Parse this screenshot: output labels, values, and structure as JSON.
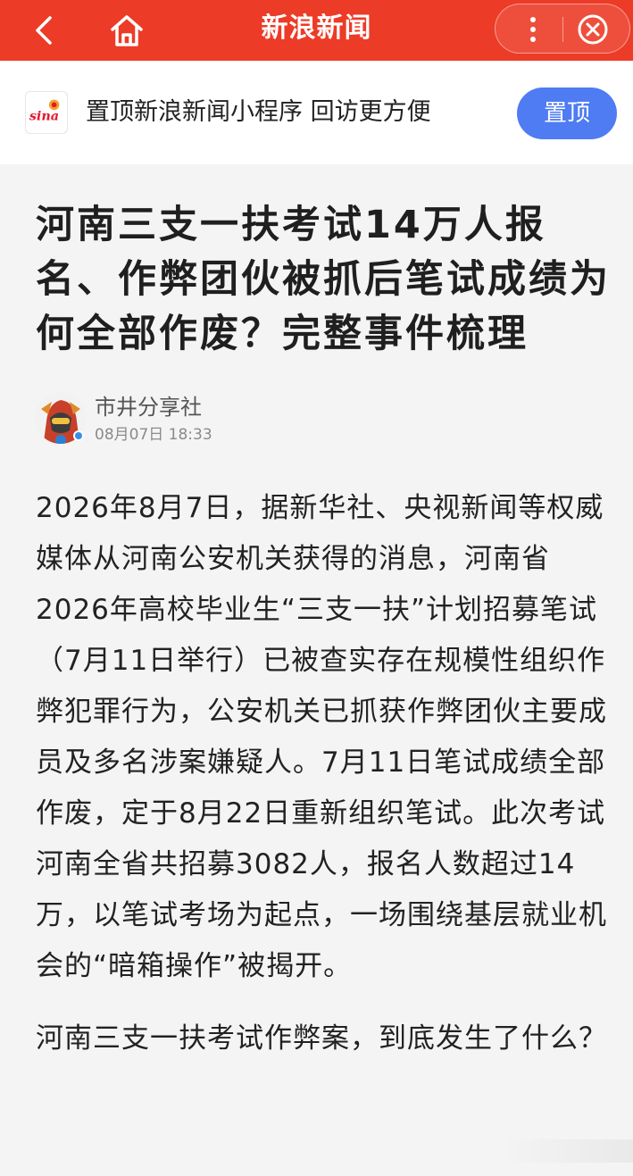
{
  "top_bar": {
    "title": "新浪新闻",
    "back_icon": "chevron-left-icon",
    "home_icon": "home-icon",
    "more_icon": "more-vertical-icon",
    "close_icon": "close-circle-icon",
    "background": "#ec3b27"
  },
  "promo": {
    "logo_text": "sina",
    "message": "置顶新浪新闻小程序 回访更方便",
    "pin_button": "置顶",
    "pin_color": "#4f7cf3"
  },
  "article": {
    "headline": "河南三支一扶考试14万人报名、作弊团伙被抓后笔试成绩为何全部作废？完整事件梳理",
    "author": {
      "name": "市井分享社",
      "time": "08月07日 18:33"
    },
    "paragraphs": [
      "2026年8月7日，据新华社、央视新闻等权威媒体从河南公安机关获得的消息，河南省2026年高校毕业生“三支一扶”计划招募笔试（7月11日举行）已被查实存在规模性组织作弊犯罪行为，公安机关已抓获作弊团伙主要成员及多名涉案嫌疑人。7月11日笔试成绩全部作废，定于8月22日重新组织笔试。此次考试河南全省共招募3082人，报名人数超过14万，以笔试考场为起点，一场围绕基层就业机会的“暗箱操作”被揭开。",
      "河南三支一扶考试作弊案，到底发生了什么？"
    ]
  }
}
